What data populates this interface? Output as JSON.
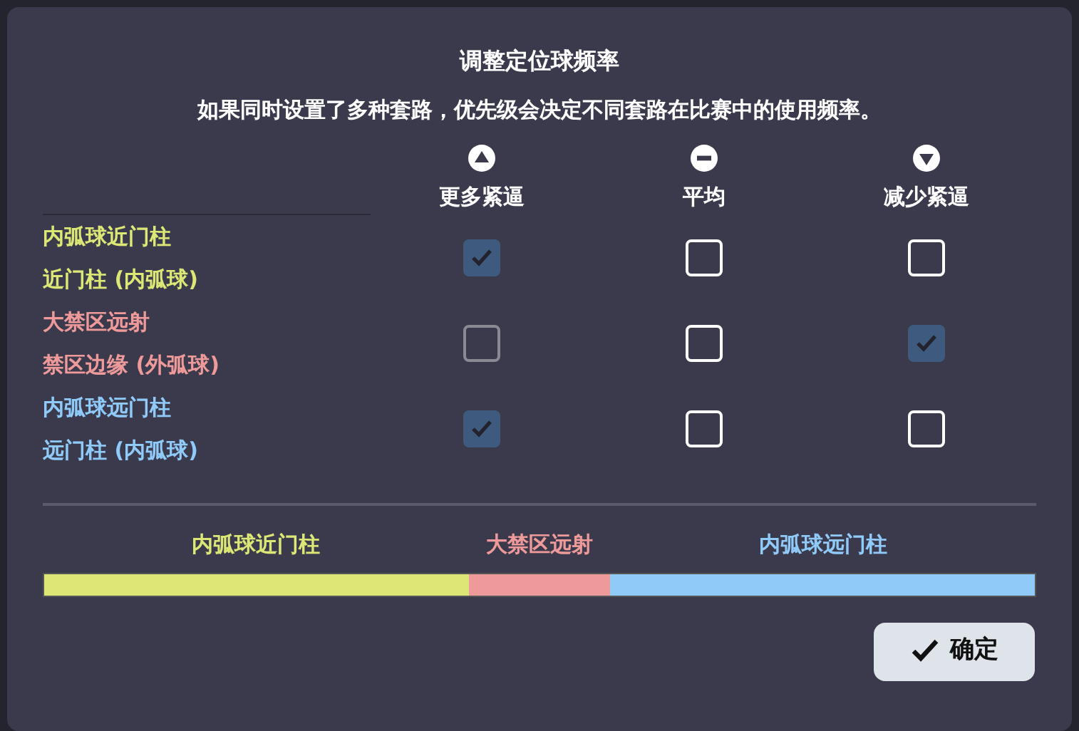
{
  "dialog": {
    "title": "调整定位球频率",
    "subtitle": "如果同时设置了多种套路，优先级会决定不同套路在比赛中的使用频率。"
  },
  "columns": [
    {
      "kind": "up",
      "label": "更多紧逼"
    },
    {
      "kind": "even",
      "label": "平均"
    },
    {
      "kind": "down",
      "label": "减少紧逼"
    }
  ],
  "routines": [
    {
      "name": "内弧球近门柱",
      "detail": "近门柱 (内弧球)",
      "color": "#dce775",
      "options": [
        {
          "checked": true,
          "disabled": false
        },
        {
          "checked": false,
          "disabled": false
        },
        {
          "checked": false,
          "disabled": false
        }
      ]
    },
    {
      "name": "大禁区远射",
      "detail": "禁区边缘 (外弧球)",
      "color": "#ef9a9a",
      "options": [
        {
          "checked": false,
          "disabled": true
        },
        {
          "checked": false,
          "disabled": false
        },
        {
          "checked": true,
          "disabled": false
        }
      ]
    },
    {
      "name": "内弧球远门柱",
      "detail": "远门柱 (内弧球)",
      "color": "#90caf9",
      "options": [
        {
          "checked": true,
          "disabled": false
        },
        {
          "checked": false,
          "disabled": false
        },
        {
          "checked": false,
          "disabled": false
        }
      ]
    }
  ],
  "share": [
    {
      "label": "内弧球近门柱",
      "color": "#dce775"
    },
    {
      "label": "大禁区远射",
      "color": "#ef9a9a"
    },
    {
      "label": "内弧球远门柱",
      "color": "#90caf9"
    }
  ],
  "confirm_button": {
    "label": "确定"
  }
}
